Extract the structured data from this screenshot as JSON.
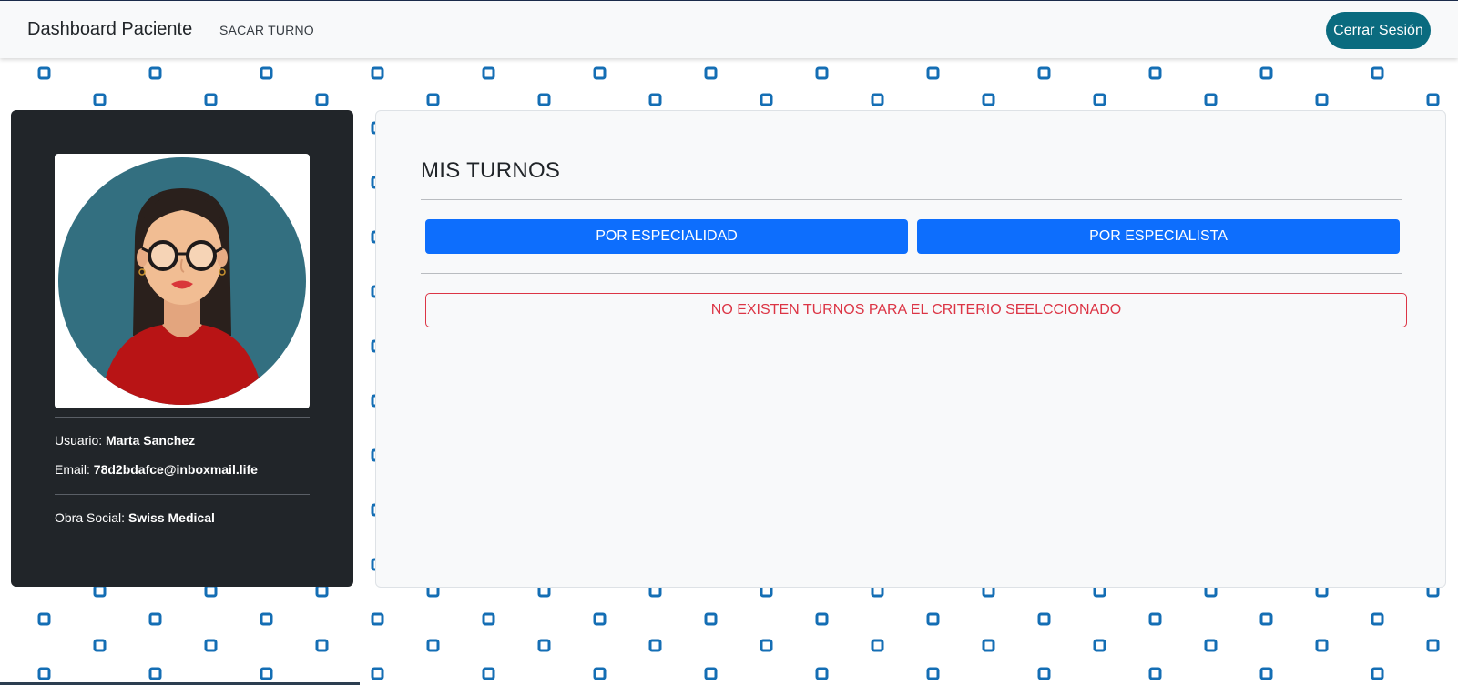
{
  "navbar": {
    "brand": "Dashboard Paciente",
    "link_sacar_turno": "SACAR TURNO",
    "logout_label": "Cerrar Sesión"
  },
  "profile": {
    "user_label": "Usuario:",
    "user_value": "Marta Sanchez",
    "email_label": "Email:",
    "email_value": "78d2bdafce@inboxmail.life",
    "insurance_label": "Obra Social:",
    "insurance_value": "Swiss Medical"
  },
  "turnos": {
    "title": "MIS TURNOS",
    "filter_specialty": "POR ESPECIALIDAD",
    "filter_specialist": "POR ESPECIALISTA",
    "empty_message": "NO EXISTEN TURNOS PARA EL CRITERIO SEELCCIONADO"
  },
  "colors": {
    "logout_bg": "#0a6b7f",
    "primary": "#0d6efd",
    "danger": "#dc3545",
    "card_dark": "#212529",
    "pattern_icon": "#146eb4"
  },
  "icons": {
    "avatar": "female-avatar-icon",
    "pattern": "medical-cross-pattern-icon"
  }
}
